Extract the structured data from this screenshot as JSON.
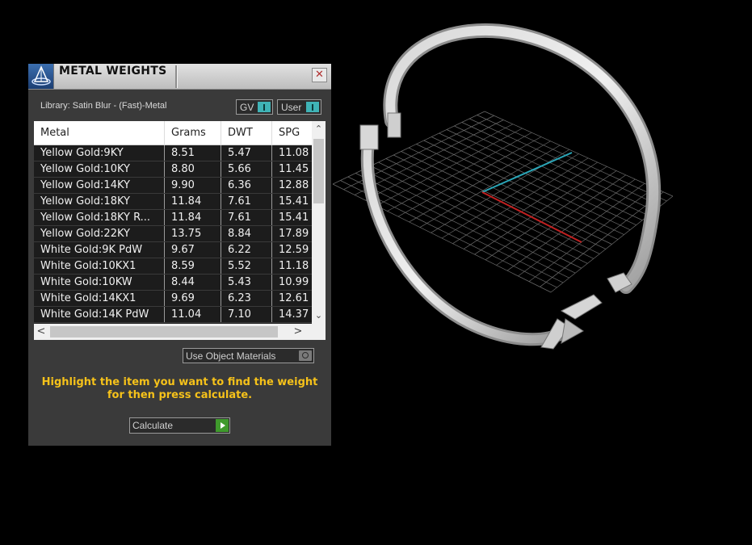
{
  "panel": {
    "title": "METAL WEIGHTS",
    "close_glyph": "✕",
    "library_label": "Library: Satin Blur - (Fast)-Metal",
    "toggles": {
      "gv_label": "GV",
      "user_label": "User"
    },
    "table": {
      "columns": [
        "Metal",
        "Grams",
        "DWT",
        "SPG"
      ],
      "rows": [
        [
          "Yellow Gold:9KY",
          "8.51",
          "5.47",
          "11.08"
        ],
        [
          "Yellow Gold:10KY",
          "8.80",
          "5.66",
          "11.45"
        ],
        [
          "Yellow Gold:14KY",
          "9.90",
          "6.36",
          "12.88"
        ],
        [
          "Yellow Gold:18KY",
          "11.84",
          "7.61",
          "15.41"
        ],
        [
          "Yellow Gold:18KY R...",
          "11.84",
          "7.61",
          "15.41"
        ],
        [
          "Yellow Gold:22KY",
          "13.75",
          "8.84",
          "17.89"
        ],
        [
          "White Gold:9K PdW",
          "9.67",
          "6.22",
          "12.59"
        ],
        [
          "White Gold:10KX1",
          "8.59",
          "5.52",
          "11.18"
        ],
        [
          "White Gold:10KW",
          "8.44",
          "5.43",
          "10.99"
        ],
        [
          "White Gold:14KX1",
          "9.69",
          "6.23",
          "12.61"
        ],
        [
          "White Gold:14K PdW",
          "11.04",
          "7.10",
          "14.37"
        ]
      ]
    },
    "scroll_glyphs": {
      "up": "⌃",
      "down": "⌄",
      "left": "<",
      "right": ">"
    },
    "use_object_materials_label": "Use Object Materials",
    "instructions": "Highlight the item you want to find the weight for then press calculate.",
    "calculate_label": "Calculate"
  },
  "viewport": {
    "object": "ring-3d-model",
    "axis_colors": {
      "x": "#c02020",
      "y": "#2aa6b8"
    },
    "grid_color": "#6a6a6a"
  }
}
